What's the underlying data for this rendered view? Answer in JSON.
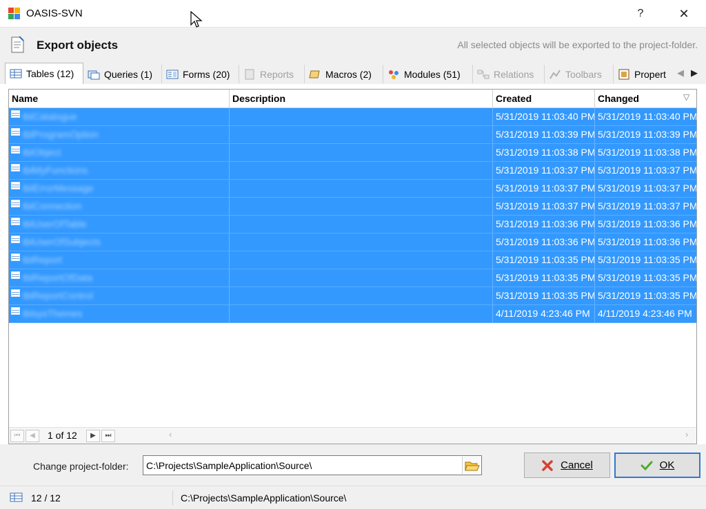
{
  "window": {
    "title": "OASIS-SVN",
    "help_label": "?",
    "close_label": "✕"
  },
  "header": {
    "heading": "Export objects",
    "hint": "All selected objects will be exported to the project-folder."
  },
  "tabs": [
    {
      "label": "Tables (12)",
      "icon": "table-icon",
      "active": true,
      "disabled": false
    },
    {
      "label": "Queries (1)",
      "icon": "query-icon",
      "active": false,
      "disabled": false
    },
    {
      "label": "Forms (20)",
      "icon": "form-icon",
      "active": false,
      "disabled": false
    },
    {
      "label": "Reports",
      "icon": "report-icon",
      "active": false,
      "disabled": true
    },
    {
      "label": "Macros (2)",
      "icon": "macro-icon",
      "active": false,
      "disabled": false
    },
    {
      "label": "Modules (51)",
      "icon": "module-icon",
      "active": false,
      "disabled": false
    },
    {
      "label": "Relations",
      "icon": "relations-icon",
      "active": false,
      "disabled": true
    },
    {
      "label": "Toolbars",
      "icon": "toolbars-icon",
      "active": false,
      "disabled": true
    },
    {
      "label": "Propert",
      "icon": "properties-icon",
      "active": false,
      "disabled": false
    }
  ],
  "grid": {
    "columns": [
      "Name",
      "Description",
      "Created",
      "Changed"
    ],
    "sort_indicator": "▽",
    "rows": [
      {
        "name": "tblCatalogue",
        "description": "",
        "created": "5/31/2019 11:03:40 PM",
        "changed": "5/31/2019 11:03:40 PM"
      },
      {
        "name": "tblProgramOption",
        "description": "",
        "created": "5/31/2019 11:03:39 PM",
        "changed": "5/31/2019 11:03:39 PM"
      },
      {
        "name": "tblObject",
        "description": "",
        "created": "5/31/2019 11:03:38 PM",
        "changed": "5/31/2019 11:03:38 PM"
      },
      {
        "name": "tblMyFunctions",
        "description": "",
        "created": "5/31/2019 11:03:37 PM",
        "changed": "5/31/2019 11:03:37 PM"
      },
      {
        "name": "tblErrorMessage",
        "description": "",
        "created": "5/31/2019 11:03:37 PM",
        "changed": "5/31/2019 11:03:37 PM"
      },
      {
        "name": "tblConnection",
        "description": "",
        "created": "5/31/2019 11:03:37 PM",
        "changed": "5/31/2019 11:03:37 PM"
      },
      {
        "name": "tblUserOfTable",
        "description": "",
        "created": "5/31/2019 11:03:36 PM",
        "changed": "5/31/2019 11:03:36 PM"
      },
      {
        "name": "tblUserOfSubjects",
        "description": "",
        "created": "5/31/2019 11:03:36 PM",
        "changed": "5/31/2019 11:03:36 PM"
      },
      {
        "name": "tblReport",
        "description": "",
        "created": "5/31/2019 11:03:35 PM",
        "changed": "5/31/2019 11:03:35 PM"
      },
      {
        "name": "tblReportOfData",
        "description": "",
        "created": "5/31/2019 11:03:35 PM",
        "changed": "5/31/2019 11:03:35 PM"
      },
      {
        "name": "tblReportControl",
        "description": "",
        "created": "5/31/2019 11:03:35 PM",
        "changed": "5/31/2019 11:03:35 PM"
      },
      {
        "name": "tblsysThemes",
        "description": "",
        "created": "4/11/2019 4:23:46 PM",
        "changed": "4/11/2019 4:23:46 PM"
      }
    ]
  },
  "navigator": {
    "position": "1 of 12",
    "first": "⏮",
    "prev": "◀",
    "next": "▶",
    "last": "⏭"
  },
  "footer": {
    "folder_label": "Change project-folder:",
    "folder_value": "C:\\Projects\\SampleApplication\\Source\\",
    "cancel_label": "Cancel",
    "ok_label": "OK"
  },
  "statusbar": {
    "count": "12 / 12",
    "path": "C:\\Projects\\SampleApplication\\Source\\"
  },
  "colors": {
    "selection": "#3399ff",
    "ok_border": "#3377cc"
  }
}
